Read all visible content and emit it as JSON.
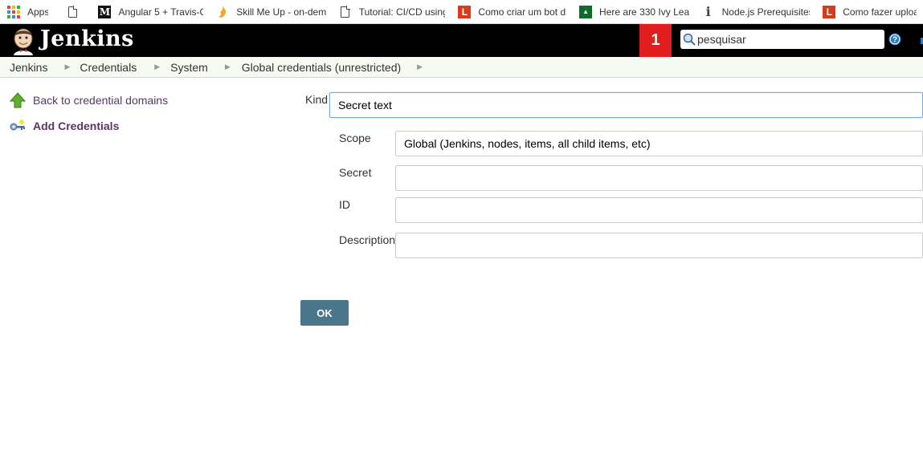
{
  "bookmarks": [
    {
      "icon": "apps-grid-icon",
      "label": "Apps"
    },
    {
      "icon": "document-icon",
      "label": ""
    },
    {
      "icon": "medium-logo-icon",
      "label": "Angular 5 + Travis-CI"
    },
    {
      "icon": "flame-icon",
      "label": "Skill Me Up - on-dem"
    },
    {
      "icon": "document-icon",
      "label": "Tutorial: CI/CD using"
    },
    {
      "icon": "l-logo-icon",
      "label": "Como criar um bot d"
    },
    {
      "icon": "green-square-icon",
      "label": "Here are 330 Ivy Leag"
    },
    {
      "icon": "info-i-icon",
      "label": "Node.js Prerequisites"
    },
    {
      "icon": "l-logo-icon",
      "label": "Como fazer uploa"
    }
  ],
  "header": {
    "brand": "Jenkins",
    "notification_count": "1",
    "search_placeholder": "pesquisar",
    "help_icon": "question-circle-icon",
    "colors": {
      "background": "#000000",
      "notification": "#e01e1e"
    }
  },
  "breadcrumb": {
    "items": [
      "Jenkins",
      "Credentials",
      "System",
      "Global credentials (unrestricted)"
    ],
    "separator_icon": "triangle-right-icon"
  },
  "side_panel": {
    "tasks": [
      {
        "icon": "up-arrow-icon",
        "label": "Back to credential domains"
      },
      {
        "icon": "key-icon",
        "label": "Add Credentials"
      }
    ]
  },
  "form": {
    "kind": {
      "label": "Kind",
      "value": "Secret text"
    },
    "scope": {
      "label": "Scope",
      "value": "Global (Jenkins, nodes, items, all child items, etc)"
    },
    "secret": {
      "label": "Secret",
      "value": ""
    },
    "id": {
      "label": "ID",
      "value": ""
    },
    "description": {
      "label": "Description",
      "value": ""
    },
    "ok_label": "OK",
    "colors": {
      "ok_button": "#4b758b",
      "link": "#5c3566"
    }
  }
}
